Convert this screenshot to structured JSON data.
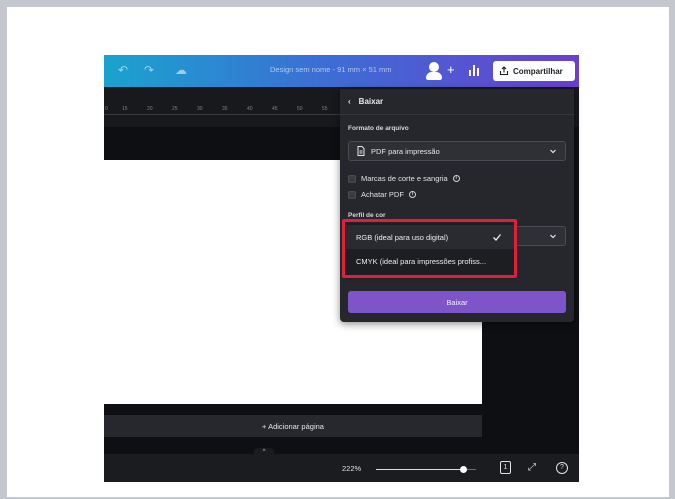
{
  "topbar": {
    "doc_title": "Design sem nome - 91 mm × 51 mm",
    "share_label": "Compartilhar",
    "icons": [
      "undo-icon",
      "redo-icon",
      "cloud-saved-icon",
      "avatar-icon",
      "plus-icon",
      "analytics-icon",
      "share-icon"
    ]
  },
  "ruler": {
    "ticks": [
      "0",
      "15",
      "20",
      "25",
      "30",
      "35",
      "40",
      "45",
      "50",
      "55"
    ]
  },
  "canvas": {
    "add_page_label": "+ Adicionar página"
  },
  "bottombar": {
    "zoom_label": "222%",
    "zoom_level_fraction": 0.87,
    "page_count": "1",
    "help_label": "?",
    "notch_label": "^"
  },
  "panel": {
    "title": "Baixar",
    "file_format_label": "Formato de arquivo",
    "file_format_value": "PDF para impressão",
    "option_crop_marks": "Marcas de corte e sangria",
    "option_flatten": "Achatar PDF",
    "color_profile_label": "Perfil de cor",
    "download_label": "Baixar"
  },
  "color_profile_options": [
    {
      "label": "RGB (ideal para uso digital)",
      "selected": true
    },
    {
      "label": "CMYK (ideal para impressões profiss...",
      "selected": false
    }
  ],
  "colors": {
    "accent_purple": "#7d55c9",
    "highlight_red": "#e0203a",
    "panel_bg": "#26272c"
  }
}
